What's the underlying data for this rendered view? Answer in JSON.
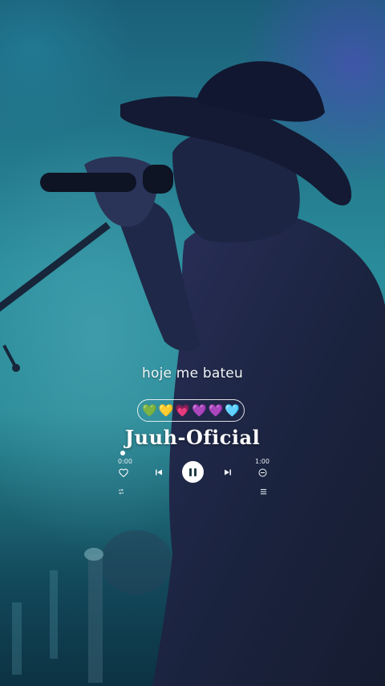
{
  "lyric": {
    "text": "hoje me bateu"
  },
  "hearts": [
    "💚",
    "💛",
    "💗",
    "💜",
    "💜",
    "🩵"
  ],
  "brand": {
    "name": "Juuh-Oficial"
  },
  "player": {
    "elapsed": "0:00",
    "duration": "1:00",
    "progress": 0.0,
    "state": "playing"
  },
  "icons": {
    "like": "heart-outline-icon",
    "previous": "skip-previous-icon",
    "pause": "pause-icon",
    "next": "skip-next-icon",
    "minus": "minus-circle-icon",
    "repeat": "repeat-icon",
    "playlist": "playlist-icon"
  },
  "colors": {
    "background_top": "#1a5f78",
    "background_mid": "#2a8d9b",
    "silhouette": "#1b2338",
    "text": "#ffffff"
  }
}
